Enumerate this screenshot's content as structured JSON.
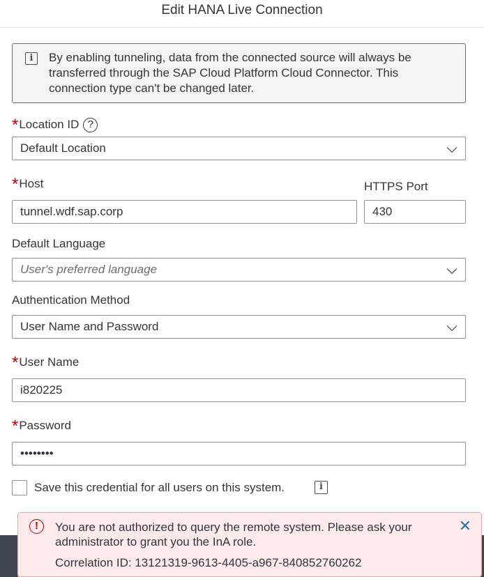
{
  "dialog": {
    "title": "Edit HANA Live Connection"
  },
  "info_strip": {
    "icon": "info-icon",
    "text": "By enabling tunneling, data from the connected source will always be transferred through the SAP Cloud Platform Cloud Connector. This connection type can't be changed later."
  },
  "form": {
    "required_marker": "*",
    "location_id": {
      "label": "Location ID",
      "help_glyph": "?",
      "value": "Default Location"
    },
    "host": {
      "label": "Host",
      "value": "tunnel.wdf.sap.corp"
    },
    "https_port": {
      "label": "HTTPS Port",
      "value": "430"
    },
    "default_language": {
      "label": "Default Language",
      "placeholder": "User's preferred language"
    },
    "authentication_method": {
      "label": "Authentication Method",
      "value": "User Name and Password"
    },
    "user_name": {
      "label": "User Name",
      "value": "i820225"
    },
    "password": {
      "label": "Password",
      "value": "••••••••"
    },
    "save_credential": {
      "label": "Save this credential for all users on this system.",
      "checked": false
    }
  },
  "error_toast": {
    "icon": "error-icon",
    "glyph": "!",
    "message": "You are not authorized to query the remote system. Please ask your administrator to grant you the InA role.",
    "correlation": "Correlation ID: 13121319-9613-4405-a967-840852760262",
    "close_glyph": "✕"
  },
  "colors": {
    "required": "#bb0000",
    "error_bg": "#ffebeb",
    "link_blue": "#2f6fa8",
    "info_bg": "#f2f4f6"
  }
}
